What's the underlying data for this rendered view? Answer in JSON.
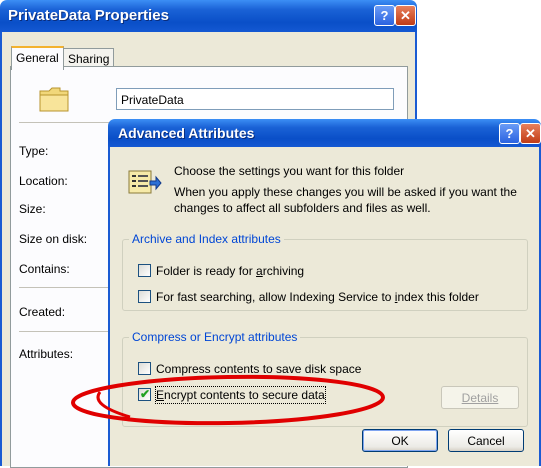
{
  "back_window": {
    "title": "PrivateData Properties",
    "tabs": [
      {
        "label": "General",
        "active": true
      },
      {
        "label": "Sharing",
        "active": false
      }
    ],
    "folder_name_value": "PrivateData",
    "labels": {
      "type": "Type:",
      "location": "Location:",
      "size": "Size:",
      "size_on_disk": "Size on disk:",
      "contains": "Contains:",
      "created": "Created:",
      "attributes": "Attributes:"
    },
    "caption_help": "?",
    "caption_close": "✕",
    "folder_icon": "folder-icon"
  },
  "dialog": {
    "title": "Advanced Attributes",
    "caption_help": "?",
    "caption_close": "✕",
    "icon": "attributes-icon",
    "intro_line1": "Choose the settings you want for this folder",
    "intro_line2": "When you apply these changes you will be asked if you want the",
    "intro_line3": "changes to affect all subfolders and files as well.",
    "archive_group": {
      "legend": "Archive and Index attributes",
      "options": [
        {
          "label_pre": "Folder is ready for ",
          "key": "a",
          "label_post": "rchiving",
          "checked": false
        },
        {
          "label_pre": "For fast searching, allow Indexing Service to ",
          "key": "i",
          "label_post": "ndex this folder",
          "checked": false
        }
      ]
    },
    "compress_group": {
      "legend": "Compress or Encrypt attributes",
      "compress_label": "Compress contents to save disk space",
      "compress_checked": false,
      "encrypt_label_key": "E",
      "encrypt_label_post": "ncrypt contents to secure data",
      "encrypt_checked": true,
      "details_label": "Details"
    },
    "ok_label": "OK",
    "cancel_label": "Cancel"
  },
  "colors": {
    "titlebar": "#0a4fc8",
    "group_legend": "#0046d5",
    "highlight_ellipse": "#e00000",
    "dialog_bg": "#ece9d8"
  }
}
